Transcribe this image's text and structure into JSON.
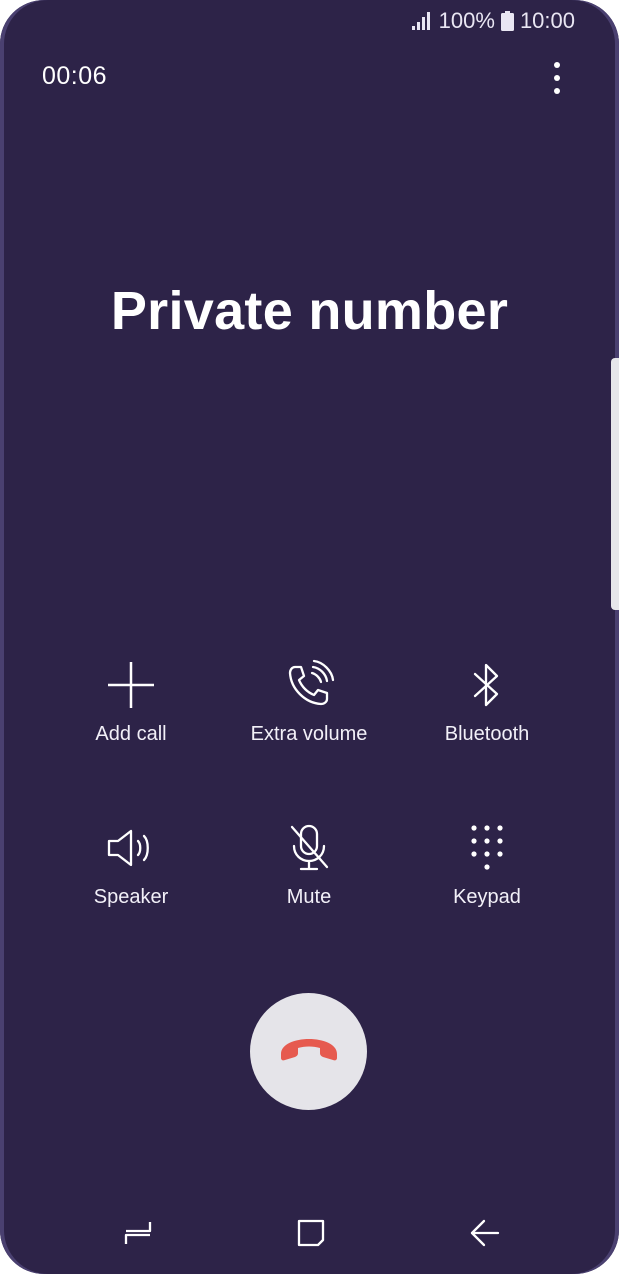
{
  "status_bar": {
    "battery": "100%",
    "time": "10:00",
    "icons": [
      "signal-icon",
      "battery-icon"
    ]
  },
  "call": {
    "duration": "00:06",
    "caller": "Private number"
  },
  "controls": {
    "add_call": "Add call",
    "extra_volume": "Extra volume",
    "bluetooth": "Bluetooth",
    "speaker": "Speaker",
    "mute": "Mute",
    "keypad": "Keypad"
  },
  "icons": {
    "menu": "more-vert-icon",
    "end_call": "end-call-icon",
    "nav": [
      "recent-apps-icon",
      "home-icon",
      "back-icon"
    ]
  },
  "colors": {
    "background": "#2d2348",
    "end_call_red": "#e65a4f",
    "end_button_bg": "#e5e4e9"
  }
}
